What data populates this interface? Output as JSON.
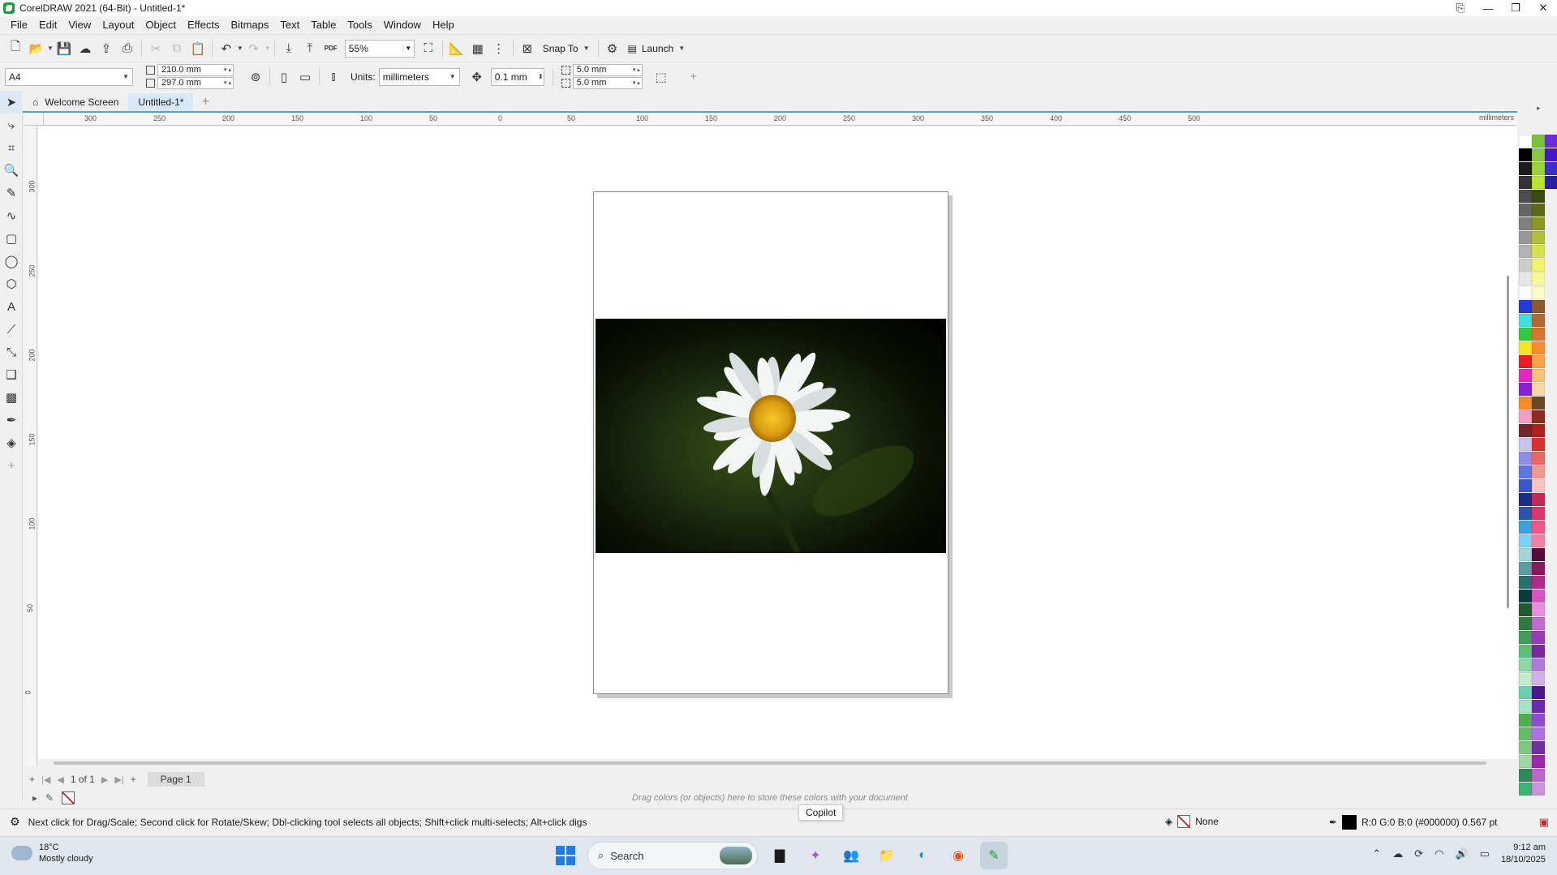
{
  "window": {
    "title": "CorelDRAW 2021 (64-Bit) - Untitled-1*"
  },
  "menu": [
    "File",
    "Edit",
    "View",
    "Layout",
    "Object",
    "Effects",
    "Bitmaps",
    "Text",
    "Table",
    "Tools",
    "Window",
    "Help"
  ],
  "toolbar": {
    "zoom": "55%",
    "snap_to": "Snap To",
    "launch": "Launch",
    "pdf_label": "PDF"
  },
  "property_bar": {
    "page_size": "A4",
    "width": "210.0 mm",
    "height": "297.0 mm",
    "units_label": "Units:",
    "units": "millimeters",
    "nudge": "0.1 mm",
    "dup_x": "5.0 mm",
    "dup_y": "5.0 mm"
  },
  "tabs": {
    "welcome": "Welcome Screen",
    "document": "Untitled-1*"
  },
  "ruler": {
    "top_labels": [
      "300",
      "250",
      "200",
      "150",
      "100",
      "50",
      "0",
      "50",
      "100",
      "150",
      "200",
      "250",
      "300",
      "350",
      "400",
      "450",
      "500"
    ],
    "unit": "millimeters",
    "left_labels": [
      "300",
      "250",
      "200",
      "150",
      "100",
      "50",
      "0"
    ],
    "left_unit": "millimeters"
  },
  "page_nav": {
    "count": "1 of 1",
    "page_tab": "Page 1"
  },
  "doc_palette_hint": "Drag colors (or objects) here to store these colors with your document",
  "status": {
    "message": "Next click for Drag/Scale; Second click for Rotate/Skew; Dbl-clicking tool selects all objects; Shift+click multi-selects; Alt+click digs",
    "fill": "None",
    "outline": "R:0 G:0 B:0 (#000000)  0.567 pt"
  },
  "tooltip": "Copilot",
  "taskbar": {
    "temp": "18°C",
    "weather": "Mostly cloudy",
    "search": "Search",
    "time": "9:12 am",
    "date": "18/10/2025"
  },
  "palette_colors": [
    [
      "#ffffff",
      "#7bc242",
      "#6d2bd9"
    ],
    [
      "#000000",
      "#8ac642",
      "#4b14c8"
    ],
    [
      "#1a1a1a",
      "#9bd43a",
      "#3b2dc9"
    ],
    [
      "#333333",
      "#b8e52f",
      "#2b1fa8"
    ],
    [
      "#4d4d4d",
      "#3c4a0c",
      null
    ],
    [
      "#666666",
      "#5f6b1a",
      null
    ],
    [
      "#7f7f7f",
      "#8a9626",
      null
    ],
    [
      "#999999",
      "#b0c03a",
      null
    ],
    [
      "#b2b2b2",
      "#d6e24a",
      null
    ],
    [
      "#cccccc",
      "#f2f26a",
      null
    ],
    [
      "#e5e5e5",
      "#f6f69a",
      null
    ],
    [
      "#ffffff",
      "#fbfbc8",
      null
    ],
    [
      "#1f3bdb",
      "#8a5a2b",
      null
    ],
    [
      "#3ee0e6",
      "#b06a34",
      null
    ],
    [
      "#32c83c",
      "#d8742c",
      null
    ],
    [
      "#f5e623",
      "#f28c34",
      null
    ],
    [
      "#e51f23",
      "#f5a44b",
      null
    ],
    [
      "#e626c4",
      "#f7c27c",
      null
    ],
    [
      "#8a1fd6",
      "#f9d6a6",
      null
    ],
    [
      "#f58e22",
      "#6a4a22",
      null
    ],
    [
      "#f29bc5",
      "#8e2a1f",
      null
    ],
    [
      "#6d2a2a",
      "#b0201f",
      null
    ],
    [
      "#c9c4ef",
      "#d8342c",
      null
    ],
    [
      "#8f8fe8",
      "#ea6a62",
      null
    ],
    [
      "#5e76e0",
      "#f19a92",
      null
    ],
    [
      "#3d57c9",
      "#f5c3c0",
      null
    ],
    [
      "#1e2d8a",
      "#c22a55",
      null
    ],
    [
      "#2a56a8",
      "#e0346e",
      null
    ],
    [
      "#3aa0e0",
      "#f0558a",
      null
    ],
    [
      "#7ccff0",
      "#f57fa7",
      null
    ],
    [
      "#a3d4d8",
      "#5a0a3a",
      null
    ],
    [
      "#5a9ea0",
      "#8a1a5f",
      null
    ],
    [
      "#2a6e72",
      "#b02c8a",
      null
    ],
    [
      "#0e3a3c",
      "#d954c2",
      null
    ],
    [
      "#1f5a2e",
      "#e88de0",
      null
    ],
    [
      "#2e7d3e",
      "#c46ad0",
      null
    ],
    [
      "#3ea056",
      "#9a3cb8",
      null
    ],
    [
      "#5ac07a",
      "#7a2aa0",
      null
    ],
    [
      "#8fd9a6",
      "#b27ad8",
      null
    ],
    [
      "#c2ebcc",
      "#d4b0ea",
      null
    ],
    [
      "#6fd0b0",
      "#4a1a8a",
      null
    ],
    [
      "#a6e3c6",
      "#6a2ab0",
      null
    ],
    [
      "#4caf50",
      "#8e4ad0",
      null
    ],
    [
      "#66bb6a",
      "#b070e0",
      null
    ],
    [
      "#81c784",
      "#7030a0",
      null
    ],
    [
      "#a5d6a7",
      "#9c27b0",
      null
    ],
    [
      "#2e8b57",
      "#ba68c8",
      null
    ],
    [
      "#3cb371",
      "#ce93d8",
      null
    ]
  ]
}
